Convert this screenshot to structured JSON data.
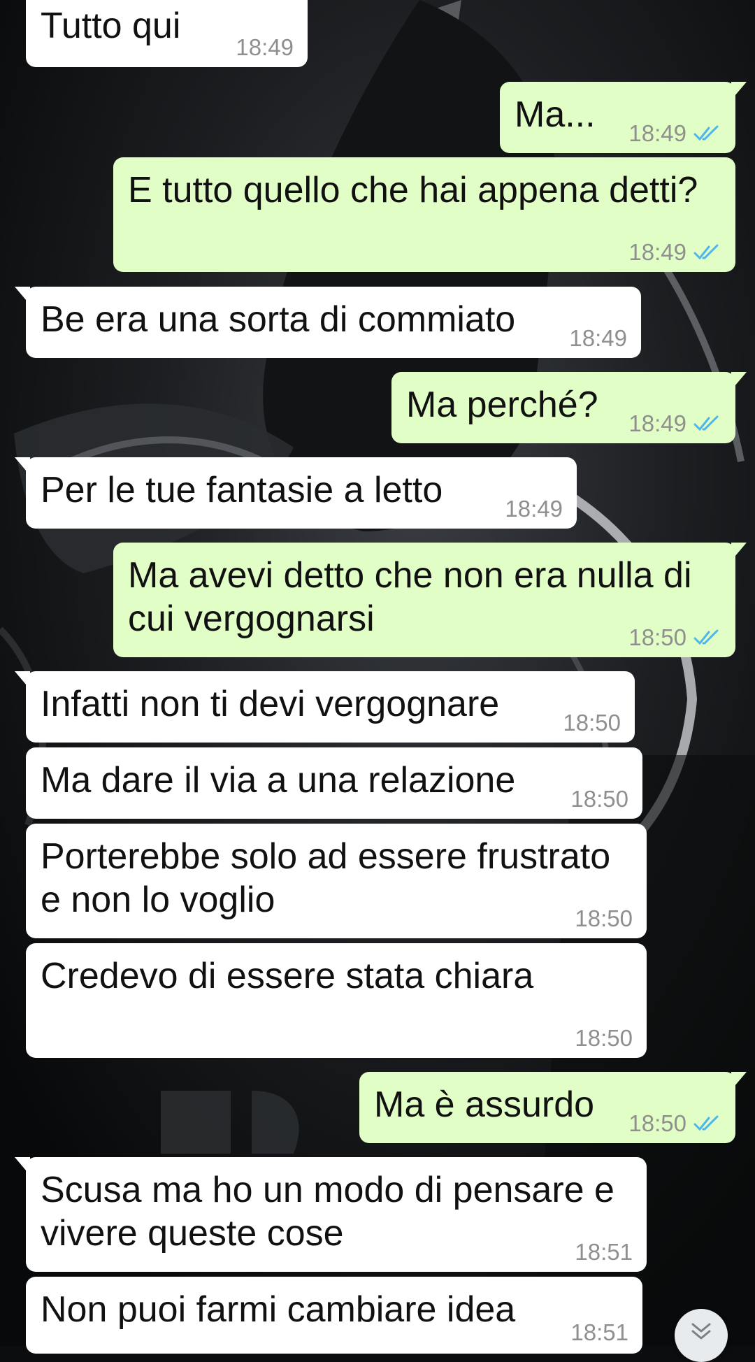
{
  "messages": [
    {
      "direction": "in",
      "text": "Tutto qui",
      "time": "18:49"
    },
    {
      "direction": "out",
      "text": "Ma...",
      "time": "18:49",
      "status": "read"
    },
    {
      "direction": "out",
      "text": "E tutto quello che hai appena detti?",
      "time": "18:49",
      "status": "read"
    },
    {
      "direction": "in",
      "text": "Be era una sorta di commiato",
      "time": "18:49"
    },
    {
      "direction": "out",
      "text": "Ma perché?",
      "time": "18:49",
      "status": "read"
    },
    {
      "direction": "in",
      "text": "Per le tue fantasie a letto",
      "time": "18:49"
    },
    {
      "direction": "out",
      "lines": [
        "Ma avevi detto che non era nulla di",
        "cui vergognarsi"
      ],
      "time": "18:50",
      "status": "read"
    },
    {
      "direction": "in",
      "text": "Infatti non ti devi vergognare",
      "time": "18:50"
    },
    {
      "direction": "in",
      "text": "Ma dare il via a una relazione",
      "time": "18:50"
    },
    {
      "direction": "in",
      "lines": [
        "Porterebbe solo ad essere frustrato",
        "e non lo voglio"
      ],
      "time": "18:50"
    },
    {
      "direction": "in",
      "text": "Credevo di essere stata chiara",
      "time": "18:50"
    },
    {
      "direction": "out",
      "text": "Ma è assurdo",
      "time": "18:50",
      "status": "read"
    },
    {
      "direction": "in",
      "lines": [
        "Scusa ma ho un modo di pensare e",
        "vivere queste cose"
      ],
      "time": "18:51"
    },
    {
      "direction": "in",
      "text": "Non puoi farmi cambiare idea",
      "time": "18:51"
    }
  ],
  "icons": {
    "read_receipt": "double-check-icon",
    "scroll_down": "chevron-double-down-icon"
  },
  "colors": {
    "incoming_bubble": "#ffffff",
    "outgoing_bubble": "#e1fec6",
    "timestamp": "#8f8f8f",
    "read_ticks": "#4fb6ec"
  }
}
